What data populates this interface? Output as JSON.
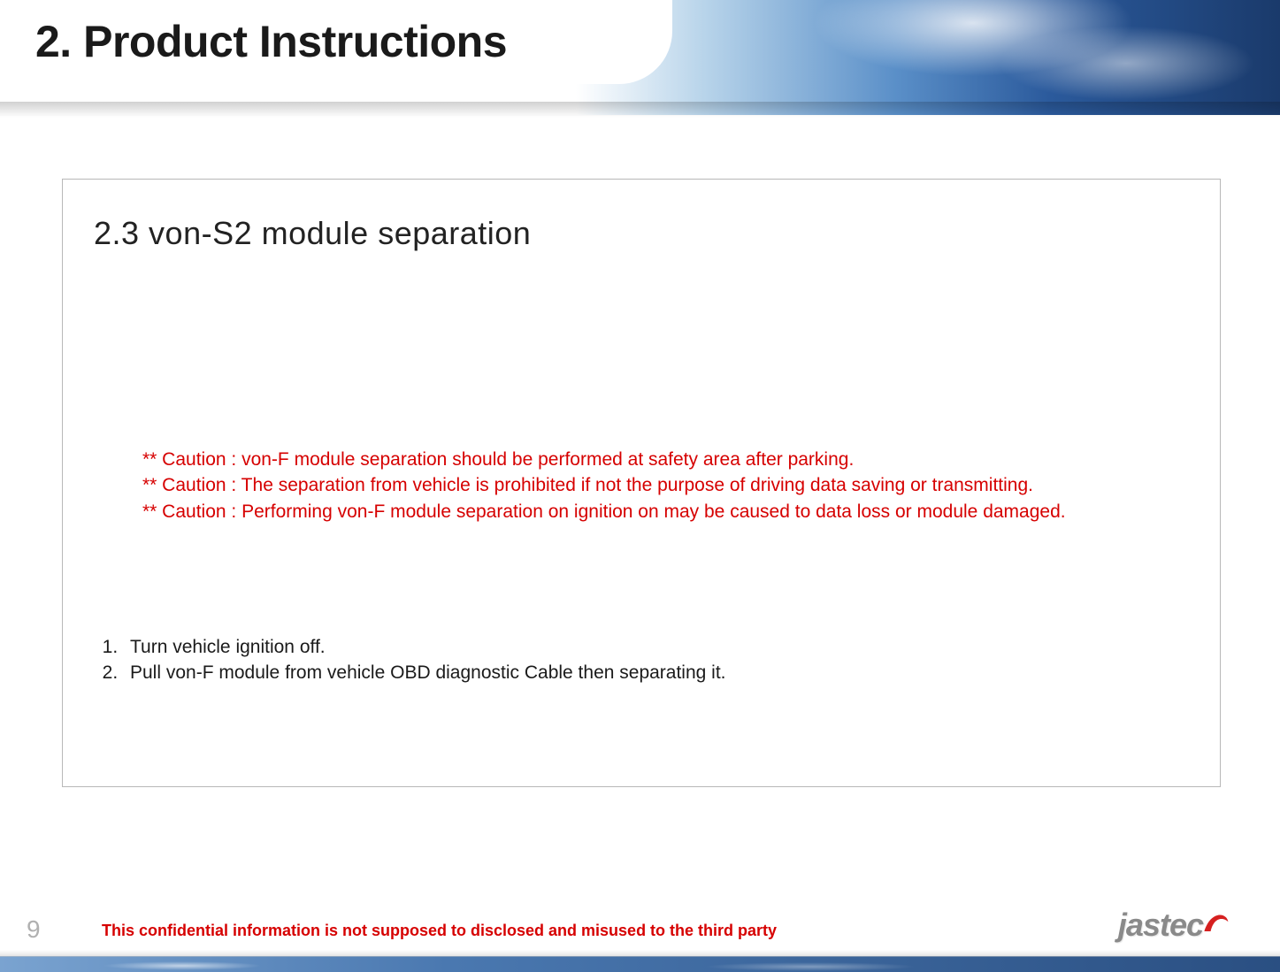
{
  "header": {
    "title": "2. Product Instructions"
  },
  "section": {
    "title": "2.3 von-S2 module separation",
    "cautions": [
      "** Caution : von-F module separation should be performed at safety area after parking.",
      "** Caution : The separation from vehicle is prohibited if not the purpose of driving data saving or transmitting.",
      "** Caution : Performing von-F module separation on ignition on may be caused to data loss or module damaged."
    ],
    "steps": [
      "Turn vehicle ignition off.",
      "Pull von-F module from vehicle OBD diagnostic Cable then separating it."
    ]
  },
  "footer": {
    "page_number": "9",
    "confidential": "This confidential information is not supposed to disclosed and misused to the third party",
    "logo_text": "jastec"
  }
}
